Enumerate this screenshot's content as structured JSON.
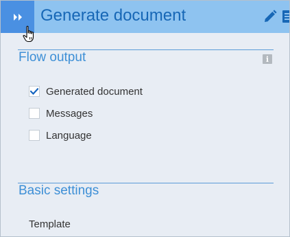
{
  "header": {
    "title": "Generate document",
    "expand_icon": "double-chevron-right-icon",
    "edit_icon": "pencil-icon",
    "background": "#8ec3f0",
    "button_color": "#4a90e2",
    "title_color": "#1767b6"
  },
  "flow_output": {
    "title": "Flow output",
    "info_icon": "info-icon",
    "info_glyph": "i",
    "options": [
      {
        "label": "Generated document",
        "checked": true
      },
      {
        "label": "Messages",
        "checked": false
      },
      {
        "label": "Language",
        "checked": false
      }
    ]
  },
  "basic_settings": {
    "title": "Basic settings",
    "fields": [
      {
        "label": "Template"
      }
    ]
  },
  "colors": {
    "panel_background": "#e8edf4",
    "section_title": "#3d8fd6",
    "checkmark": "#1565c0"
  }
}
